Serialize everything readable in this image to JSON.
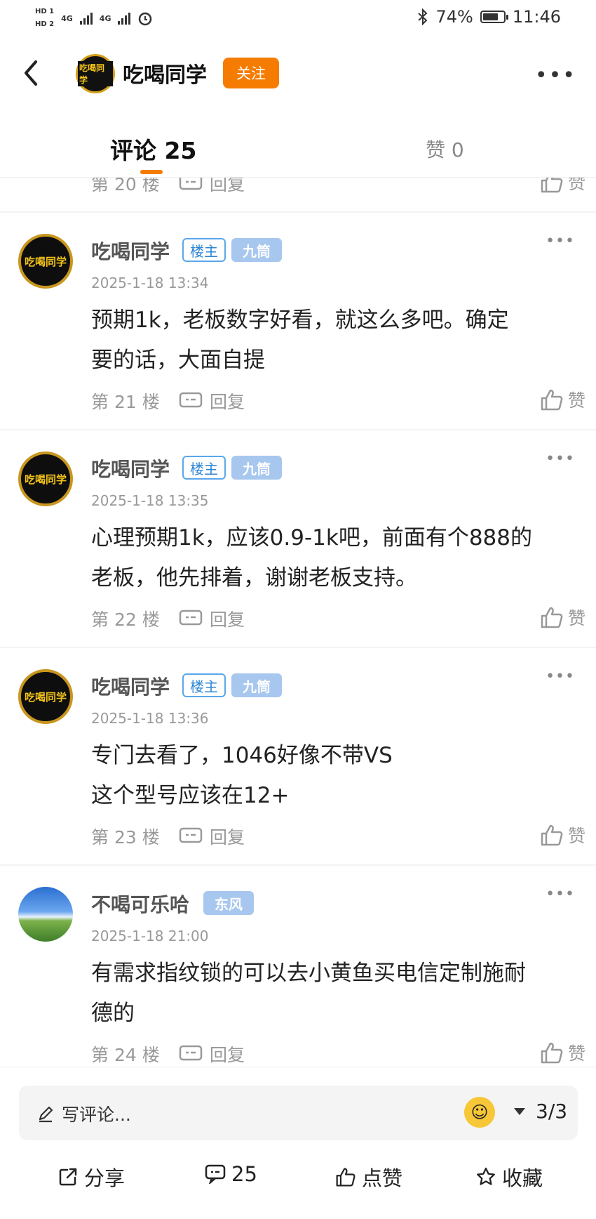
{
  "status_bar": {
    "hd1": "HD 1",
    "hd2": "HD 2",
    "net1": "4G",
    "net2": "4G",
    "battery_percent": "74%",
    "battery_level": 0.74,
    "time": "11:46"
  },
  "header": {
    "title": "吃喝同学",
    "avatar_text": "吃喝同学",
    "follow_label": "关注",
    "more": "•••"
  },
  "tabs": {
    "comments": "评论 25",
    "likes": "赞 0"
  },
  "partial_comment": {
    "floor": "第 20 楼",
    "reply": "回复",
    "like": "赞"
  },
  "comments": [
    {
      "name": "吃喝同学",
      "avatar_text": "吃喝同学",
      "owner_badge": "楼主",
      "rank_badge": "九筒",
      "date": "2025-1-18 13:34",
      "content_line1": "预期1k，老板数字好看，就这么多吧。确定",
      "content_line2": "要的话，大面自提",
      "floor": "第 21 楼",
      "reply": "回复",
      "like": "赞",
      "more": "•••"
    },
    {
      "name": "吃喝同学",
      "avatar_text": "吃喝同学",
      "owner_badge": "楼主",
      "rank_badge": "九筒",
      "date": "2025-1-18 13:35",
      "content_line1": "心理预期1k，应该0.9-1k吧，前面有个888的",
      "content_line2": "老板，他先排着，谢谢老板支持。",
      "floor": "第 22 楼",
      "reply": "回复",
      "like": "赞",
      "more": "•••"
    },
    {
      "name": "吃喝同学",
      "avatar_text": "吃喝同学",
      "owner_badge": "楼主",
      "rank_badge": "九筒",
      "date": "2025-1-18 13:36",
      "content_line1": "专门去看了，1046好像不带VS",
      "content_line2": "这个型号应该在12+",
      "floor": "第 23 楼",
      "reply": "回复",
      "like": "赞",
      "more": "•••"
    },
    {
      "name": "不喝可乐哈",
      "rank_badge": "东风",
      "date": "2025-1-18 21:00",
      "content_line1": "有需求指纹锁的可以去小黄鱼买电信定制施耐",
      "content_line2": "德的",
      "floor": "第 24 楼",
      "reply": "回复",
      "like": "赞",
      "more": "•••"
    }
  ],
  "bottom": {
    "input_placeholder": "写评论...",
    "page_indicator": "3/3",
    "share": "分享",
    "comment_count": "25",
    "like": "点赞",
    "favorite": "收藏"
  },
  "colors": {
    "accent": "#f57c00",
    "owner_badge": "#2d86d6",
    "rank_badge_bg": "#a7c7ee"
  },
  "icons": [
    "back-icon",
    "bluetooth-icon",
    "battery-icon",
    "alarm-icon",
    "reply-icon",
    "thumb-up-icon",
    "edit-icon",
    "emoji-icon",
    "dropdown-icon",
    "share-icon",
    "comment-icon",
    "star-icon"
  ]
}
